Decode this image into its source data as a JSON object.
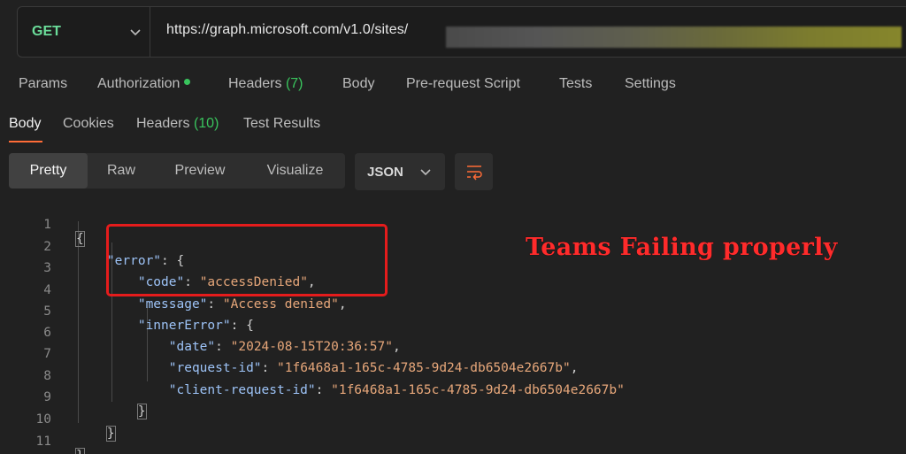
{
  "request": {
    "method": "GET",
    "url": "https://graph.microsoft.com/v1.0/sites/"
  },
  "request_tabs": [
    {
      "label": "Params"
    },
    {
      "label": "Authorization",
      "indicator": "green-dot"
    },
    {
      "label": "Headers",
      "count": "(7)"
    },
    {
      "label": "Body"
    },
    {
      "label": "Pre-request Script"
    },
    {
      "label": "Tests"
    },
    {
      "label": "Settings"
    }
  ],
  "response_tabs": [
    {
      "label": "Body",
      "active": true
    },
    {
      "label": "Cookies"
    },
    {
      "label": "Headers",
      "count": "(10)"
    },
    {
      "label": "Test Results"
    }
  ],
  "view_modes": [
    {
      "label": "Pretty",
      "active": true
    },
    {
      "label": "Raw"
    },
    {
      "label": "Preview"
    },
    {
      "label": "Visualize"
    }
  ],
  "format": {
    "selected": "JSON"
  },
  "icons": {
    "method_dropdown": "chevron-down-icon",
    "format_dropdown": "chevron-down-icon",
    "wrap": "wrap-lines-icon"
  },
  "colors": {
    "method": "#6bdd9a",
    "accent_underline": "#ff6c37",
    "count": "#39c45d",
    "annotation": "#ff2b2b",
    "highlight_box": "#e51c1c"
  },
  "code_lines": [
    {
      "n": "1"
    },
    {
      "n": "2"
    },
    {
      "n": "3"
    },
    {
      "n": "4"
    },
    {
      "n": "5"
    },
    {
      "n": "6"
    },
    {
      "n": "7"
    },
    {
      "n": "8"
    },
    {
      "n": "9"
    },
    {
      "n": "10"
    },
    {
      "n": "11"
    }
  ],
  "json": {
    "error_key": "\"error\"",
    "code_key": "\"code\"",
    "code_val": "\"accessDenied\"",
    "message_key": "\"message\"",
    "message_val": "\"Access denied\"",
    "inner_key": "\"innerError\"",
    "date_key": "\"date\"",
    "date_val": "\"2024-08-15T20:36:57\"",
    "request_id_key": "\"request-id\"",
    "request_id_val": "\"1f6468a1-165c-4785-9d24-db6504e2667b\"",
    "client_request_id_key": "\"client-request-id\"",
    "client_request_id_val": "\"1f6468a1-165c-4785-9d24-db6504e2667b\""
  },
  "annotation": "Teams Failing properly"
}
